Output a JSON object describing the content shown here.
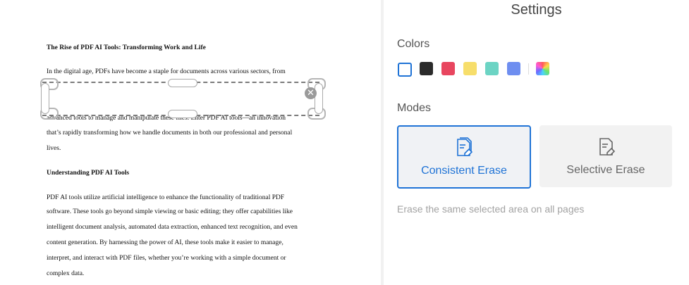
{
  "document": {
    "title": "The Rise of PDF AI Tools: Transforming Work and Life",
    "lines": [
      "In the digital age, PDFs have become a staple for documents across various sectors, from",
      "advanced tools to manage and manipulate these files. Enter PDF AI tools—an innovation",
      "that’s rapidly transforming how we handle documents in both our professional and personal",
      "lives."
    ],
    "heading2": "Understanding PDF AI Tools",
    "lines2": [
      "PDF AI tools utilize artificial intelligence to enhance the functionality of traditional PDF",
      "software. These tools go beyond simple viewing or basic editing; they offer capabilities like",
      "intelligent document analysis, automated data extraction, enhanced text recognition, and even",
      "content generation. By harnessing the power of AI, these tools make it easier to manage,",
      "interpret, and interact with PDF files, whether you’re working with a simple document or",
      "complex data."
    ],
    "close_glyph": "✕"
  },
  "settings": {
    "title": "Settings",
    "colors_label": "Colors",
    "colors": [
      {
        "name": "white",
        "hex": "#ffffff"
      },
      {
        "name": "black",
        "hex": "#2b2b2b"
      },
      {
        "name": "red",
        "hex": "#e8465f"
      },
      {
        "name": "yellow",
        "hex": "#f7de6b"
      },
      {
        "name": "teal",
        "hex": "#6cd4c4"
      },
      {
        "name": "blue",
        "hex": "#6e8ef0"
      },
      {
        "name": "rainbow",
        "hex": "multicolor"
      }
    ],
    "selected_color": "white",
    "modes_label": "Modes",
    "modes": [
      {
        "label": "Consistent Erase",
        "selected": true
      },
      {
        "label": "Selective Erase",
        "selected": false
      }
    ],
    "description": "Erase the same selected area on all pages",
    "accent": "#1f73d6"
  }
}
